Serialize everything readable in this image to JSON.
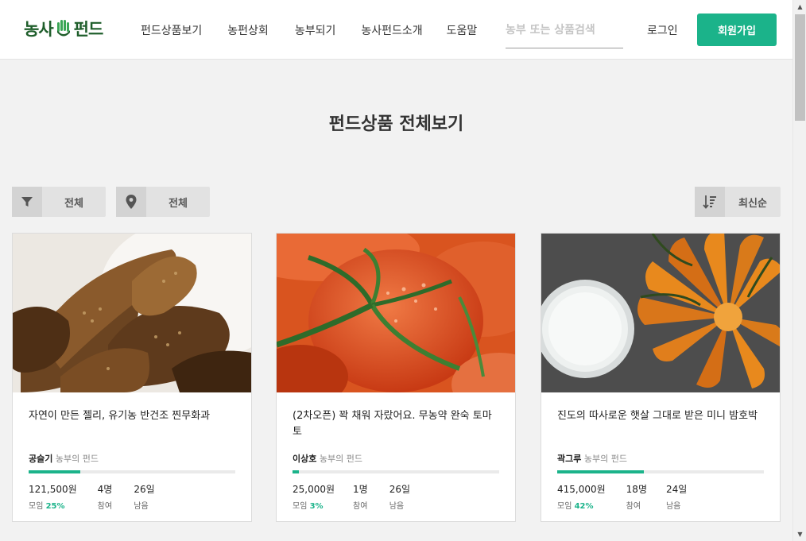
{
  "logo": {
    "left": "농사",
    "right": "펀드"
  },
  "nav": [
    "펀드상품보기",
    "농펀상회",
    "농부되기",
    "농사펀드소개",
    "도움말"
  ],
  "search": {
    "placeholder": "농부 또는 상품검색"
  },
  "auth": {
    "login": "로그인",
    "signup": "회원가입"
  },
  "page_title": "펀드상품 전체보기",
  "filters": {
    "category": {
      "icon": "filter-icon",
      "label": "전체"
    },
    "location": {
      "icon": "location-pin-icon",
      "label": "전체"
    },
    "sort": {
      "icon": "sort-icon",
      "label": "최신순"
    }
  },
  "funds": [
    {
      "title": "자연이 만든 젤리, 유기농 반건조 찐무화과",
      "farmer": "공슬기",
      "farmer_suffix": "농부의 펀드",
      "progress": 0.25,
      "amount": "121,500원",
      "amount_label": "모임",
      "percent": "25%",
      "participants": "4명",
      "participants_label": "참여",
      "days": "26일",
      "days_label": "남음",
      "image": "dried-fig-photo"
    },
    {
      "title": "(2차오픈) 꽉 채워 자랐어요. 무농약 완숙 토마토",
      "farmer": "이상호",
      "farmer_suffix": "농부의 펀드",
      "progress": 0.03,
      "amount": "25,000원",
      "amount_label": "모임",
      "percent": "3%",
      "participants": "1명",
      "participants_label": "참여",
      "days": "26일",
      "days_label": "남음",
      "image": "tomato-photo"
    },
    {
      "title": "진도의 따사로운 햇살 그대로 받은 미니 밤호박",
      "farmer": "곽그루",
      "farmer_suffix": "농부의 펀드",
      "progress": 0.42,
      "amount": "415,000원",
      "amount_label": "모임",
      "percent": "42%",
      "participants": "18명",
      "participants_label": "참여",
      "days": "24일",
      "days_label": "남음",
      "image": "pumpkin-photo"
    }
  ],
  "colors": {
    "accent": "#1bb38a",
    "logo": "#1f5e2b"
  }
}
